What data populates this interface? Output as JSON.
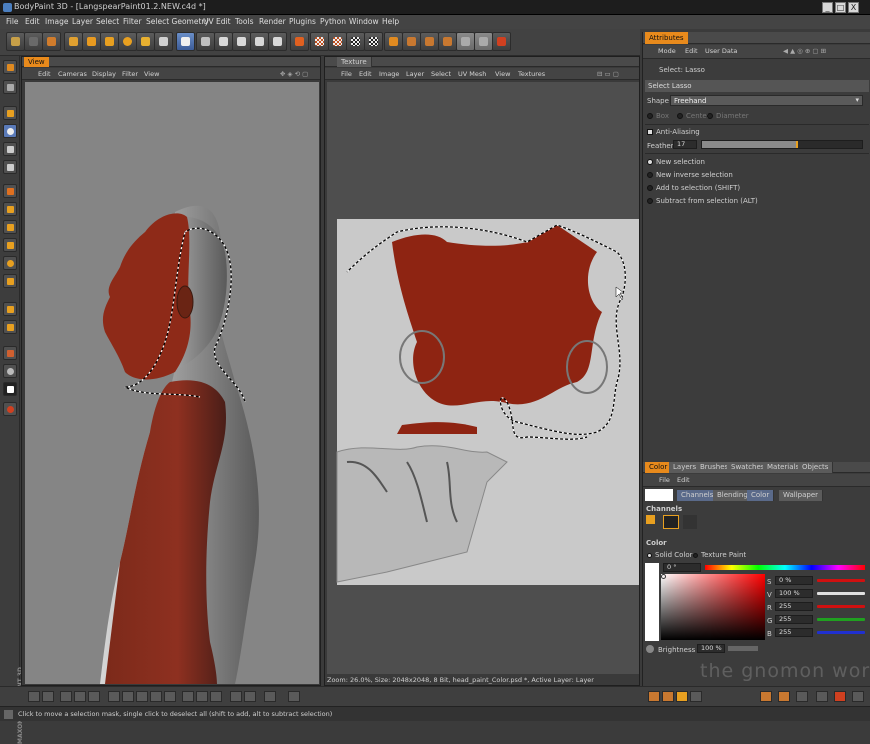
{
  "window": {
    "title": "BodyPaint 3D - [LangspearPaint01.2.NEW.c4d *]",
    "minimize": "_",
    "maximize": "□",
    "close": "X"
  },
  "menu": [
    "File",
    "Edit",
    "Image",
    "Layer",
    "Select",
    "Filter",
    "Select Geometry",
    "UV Edit",
    "Tools",
    "Render",
    "Plugins",
    "Python",
    "Window",
    "Help"
  ],
  "view_panel": {
    "tab": "View",
    "menu": [
      "Edit",
      "Cameras",
      "Display",
      "Filter",
      "View"
    ]
  },
  "texture_panel": {
    "tab": "Texture",
    "menu": [
      "File",
      "Edit",
      "Image",
      "Layer",
      "Select",
      "UV Mesh",
      "View",
      "Textures"
    ],
    "status": "Zoom: 26.0%, Size: 2048x2048, 8 Bit, head_paint_Color.psd *, Active Layer: Layer"
  },
  "attributes": {
    "tab": "Attributes",
    "menu": [
      "Mode",
      "Edit",
      "User Data"
    ],
    "tool_name": "Select: Lasso",
    "section": "Select Lasso",
    "shape_label": "Shape",
    "shape_value": "Freehand",
    "shape_options": [
      "Box",
      "Center",
      "Diameter"
    ],
    "anti_aliasing": "Anti-Aliasing",
    "feather_label": "Feather",
    "feather_value": "17",
    "feather_fraction": 0.6,
    "modes": [
      "New selection",
      "New inverse selection",
      "Add to selection (SHIFT)",
      "Subtract from selection (ALT)"
    ]
  },
  "color_panel": {
    "tabs": [
      "Color",
      "Layers",
      "Brushes",
      "Swatches",
      "Materials",
      "Objects"
    ],
    "menu": [
      "File",
      "Edit"
    ],
    "subtabs": [
      "Channels",
      "Blending",
      "Color",
      "Wallpaper"
    ],
    "channels_label": "Channels",
    "color_label": "Color",
    "mode_solid": "Solid Color",
    "mode_texture": "Texture Paint",
    "hue_value": "0 °",
    "sliders": [
      {
        "label": "S",
        "value": "0 %",
        "color": "#d01010"
      },
      {
        "label": "V",
        "value": "100 %",
        "color": "#e0e0e0"
      },
      {
        "label": "R",
        "value": "255",
        "color": "#d01010"
      },
      {
        "label": "G",
        "value": "255",
        "color": "#20a020"
      },
      {
        "label": "B",
        "value": "255",
        "color": "#2030d0"
      }
    ],
    "brightness_label": "Brightness",
    "brightness_value": "100 %"
  },
  "status_bar": "Click to move a selection mask, single click to deselect all (shift to add, alt to subtract selection)",
  "watermark": "the gnomon workshop",
  "colors": {
    "accent": "#e88a1c",
    "paint_red": "#8e2412",
    "panel_bg": "#3c3c3c"
  }
}
